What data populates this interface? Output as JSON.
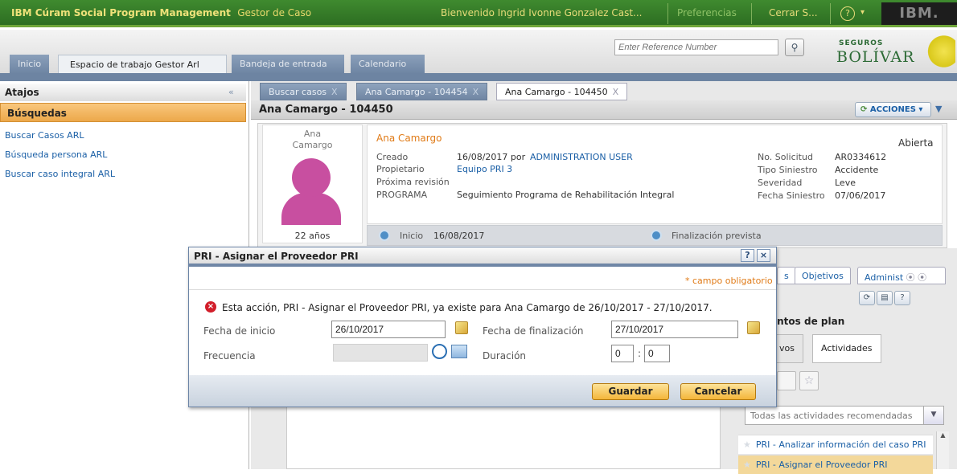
{
  "topbar": {
    "app_name": "IBM Cúram Social Program Management",
    "app_role": "Gestor de Caso",
    "welcome": "Bienvenido Ingrid Ivonne Gonzalez Cast...",
    "preferences": "Preferencias",
    "logout": "Cerrar S...",
    "help": "?",
    "vendor": "IBM."
  },
  "header": {
    "reference_placeholder": "Enter Reference Number",
    "logo_top": "SEGUROS",
    "logo_main": "BOLÍVAR"
  },
  "main_tabs": [
    "Inicio",
    "Espacio de trabajo Gestor Arl",
    "Bandeja de entrada",
    "Calendario"
  ],
  "sidebar": {
    "title": "Atajos",
    "section": "Búsquedas",
    "links": [
      "Buscar Casos ARL",
      "Búsqueda persona ARL",
      "Buscar caso integral ARL"
    ]
  },
  "content_tabs": [
    "Buscar casos",
    "Ana Camargo - 104454",
    "Ana Camargo - 104450"
  ],
  "case": {
    "title": "Ana Camargo - 104450",
    "actions": "ACCIONES",
    "person_name_line1": "Ana",
    "person_name_line2": "Camargo",
    "age": "22 años",
    "name": "Ana Camargo",
    "status": "Abierta",
    "created_label": "Creado",
    "created_date": "16/08/2017 por",
    "created_by": "ADMINISTRATION USER",
    "owner_label": "Propietario",
    "owner": "Equipo PRI 3",
    "next_review_label": "Próxima revisión",
    "program_label": "PROGRAMA",
    "program": "Seguimiento Programa de Rehabilitación Integral",
    "request_label": "No. Solicitud",
    "request": "AR0334612",
    "claim_type_label": "Tipo Siniestro",
    "claim_type": "Accidente",
    "severity_label": "Severidad",
    "severity": "Leve",
    "claim_date_label": "Fecha Siniestro",
    "claim_date": "07/06/2017",
    "start_label": "Inicio",
    "start_date": "16/08/2017",
    "end_label": "Finalización prevista"
  },
  "plan": {
    "tabs": [
      "s",
      "Objetivos",
      "Administ"
    ],
    "elements_title": "entos de plan",
    "subtabs": [
      "vos",
      "Actividades"
    ],
    "filter": "Todas las actividades recomendadas",
    "activities": [
      "PRI - Analizar información del caso PRI",
      "PRI - Asignar el Proveedor PRI"
    ]
  },
  "dialog": {
    "title": "PRI - Asignar el Proveedor PRI",
    "required_note": "* campo obligatorio",
    "error": "Esta acción, PRI - Asignar el Proveedor PRI, ya existe para Ana Camargo de 26/10/2017 - 27/10/2017.",
    "start_label": "Fecha de inicio",
    "start_value": "26/10/2017",
    "end_label": "Fecha de finalización",
    "end_value": "27/10/2017",
    "frequency_label": "Frecuencia",
    "duration_label": "Duración",
    "duration_hours": "0",
    "duration_minutes": "0",
    "duration_sep": ":",
    "save": "Guardar",
    "cancel": "Cancelar",
    "help_btn": "?",
    "close_btn": "×"
  }
}
